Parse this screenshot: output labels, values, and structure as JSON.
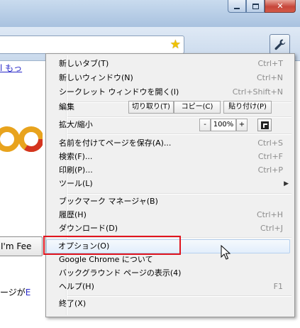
{
  "page": {
    "links_text": "l  もっ",
    "search_button": "I'm Fee",
    "bottom_text_prefix": "ージが",
    "bottom_text_link": "E"
  },
  "menu": {
    "group1": [
      {
        "label": "新しいタブ(T)",
        "shortcut": "Ctrl+T"
      },
      {
        "label": "新しいウィンドウ(N)",
        "shortcut": "Ctrl+N"
      },
      {
        "label": "シークレット ウィンドウを開く(I)",
        "shortcut": "Ctrl+Shift+N"
      }
    ],
    "edit": {
      "label": "編集",
      "cut": "切り取り(T)",
      "copy": "コピー(C)",
      "paste": "貼り付け(P)"
    },
    "zoom": {
      "label": "拡大/縮小",
      "minus": "-",
      "value": "100%",
      "plus": "+"
    },
    "group2": [
      {
        "label": "名前を付けてページを保存(A)...",
        "shortcut": "Ctrl+S"
      },
      {
        "label": "検索(F)...",
        "shortcut": "Ctrl+F"
      },
      {
        "label": "印刷(P)...",
        "shortcut": "Ctrl+P"
      },
      {
        "label": "ツール(L)",
        "shortcut": ""
      }
    ],
    "group3": [
      {
        "label": "ブックマーク マネージャ(B)",
        "shortcut": "Ctrl+Shift+B"
      },
      {
        "label": "履歴(H)",
        "shortcut": "Ctrl+H"
      },
      {
        "label": "ダウンロード(D)",
        "shortcut": "Ctrl+J"
      }
    ],
    "group4": [
      {
        "label": "オプション(O)",
        "shortcut": ""
      },
      {
        "label": "Google Chrome について",
        "shortcut": ""
      },
      {
        "label": "バックグラウンド ページの表示(4)",
        "shortcut": ""
      },
      {
        "label": "ヘルプ(H)",
        "shortcut": "F1"
      }
    ],
    "exit": {
      "label": "終了(X)"
    }
  },
  "colors": {
    "highlight": "#e0141e",
    "menu_bg": "#f0f0f0",
    "link": "#2a2ac8"
  },
  "icons": [
    "minimize-icon",
    "maximize-icon",
    "close-icon",
    "star-icon",
    "wrench-icon",
    "fullscreen-icon",
    "submenu-arrow-icon",
    "mouse-cursor-icon"
  ]
}
